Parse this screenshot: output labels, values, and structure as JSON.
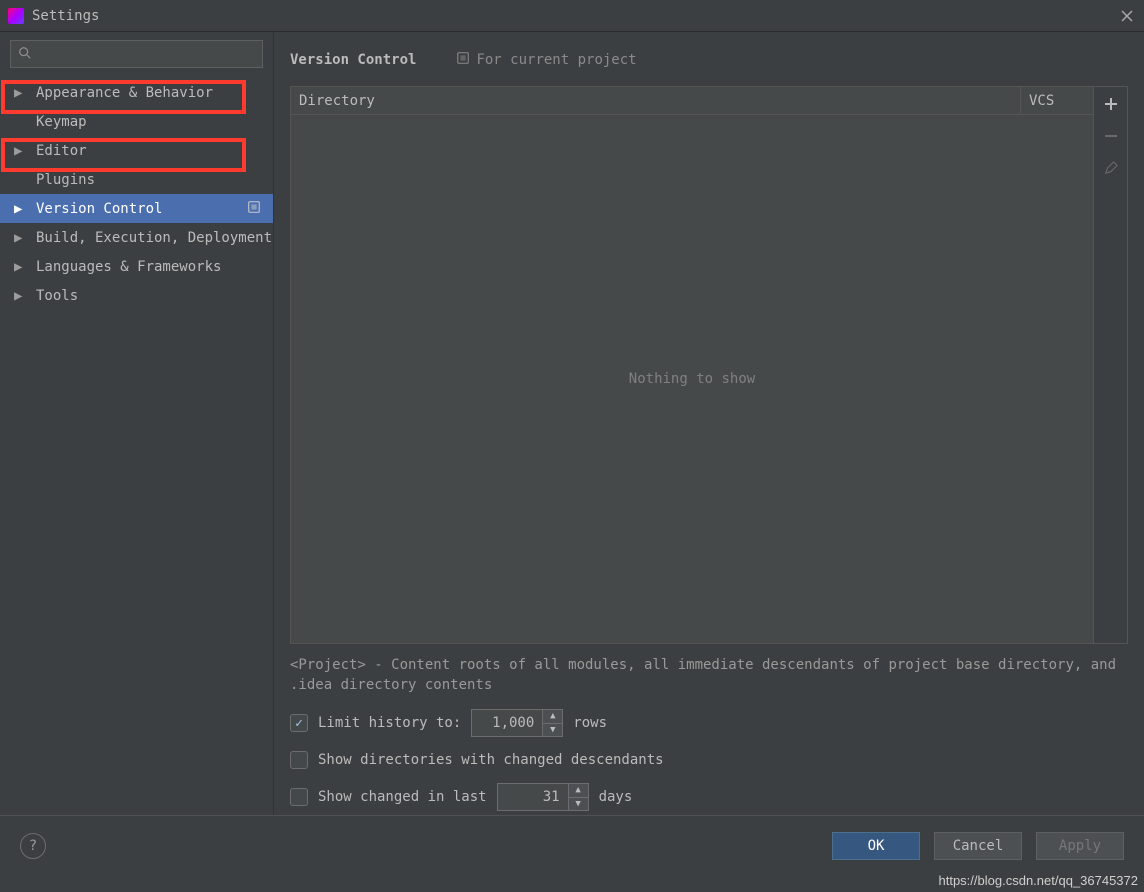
{
  "window": {
    "title": "Settings"
  },
  "sidebar": {
    "search_placeholder": "",
    "items": [
      {
        "label": "Appearance & Behavior",
        "expandable": true
      },
      {
        "label": "Keymap",
        "expandable": false
      },
      {
        "label": "Editor",
        "expandable": true
      },
      {
        "label": "Plugins",
        "expandable": false
      },
      {
        "label": "Version Control",
        "expandable": true,
        "selected": true,
        "project_scope": true
      },
      {
        "label": "Build, Execution, Deployment",
        "expandable": true
      },
      {
        "label": "Languages & Frameworks",
        "expandable": true
      },
      {
        "label": "Tools",
        "expandable": true
      }
    ]
  },
  "content": {
    "title": "Version Control",
    "for_project_label": "For current project",
    "table": {
      "columns": {
        "directory": "Directory",
        "vcs": "VCS"
      },
      "empty_text": "Nothing to show"
    },
    "description": "<Project> - Content roots of all modules, all immediate descendants of project base directory, and .idea directory contents",
    "options": {
      "limit_history": {
        "checked": true,
        "label": "Limit history to:",
        "value": "1,000",
        "suffix": "rows"
      },
      "show_dirs": {
        "checked": false,
        "label": "Show directories with changed descendants"
      },
      "show_changed": {
        "checked": false,
        "label": "Show changed in last",
        "value": "31",
        "suffix": "days"
      }
    }
  },
  "footer": {
    "ok": "OK",
    "cancel": "Cancel",
    "apply": "Apply"
  },
  "watermark": "https://blog.csdn.net/qq_36745372"
}
